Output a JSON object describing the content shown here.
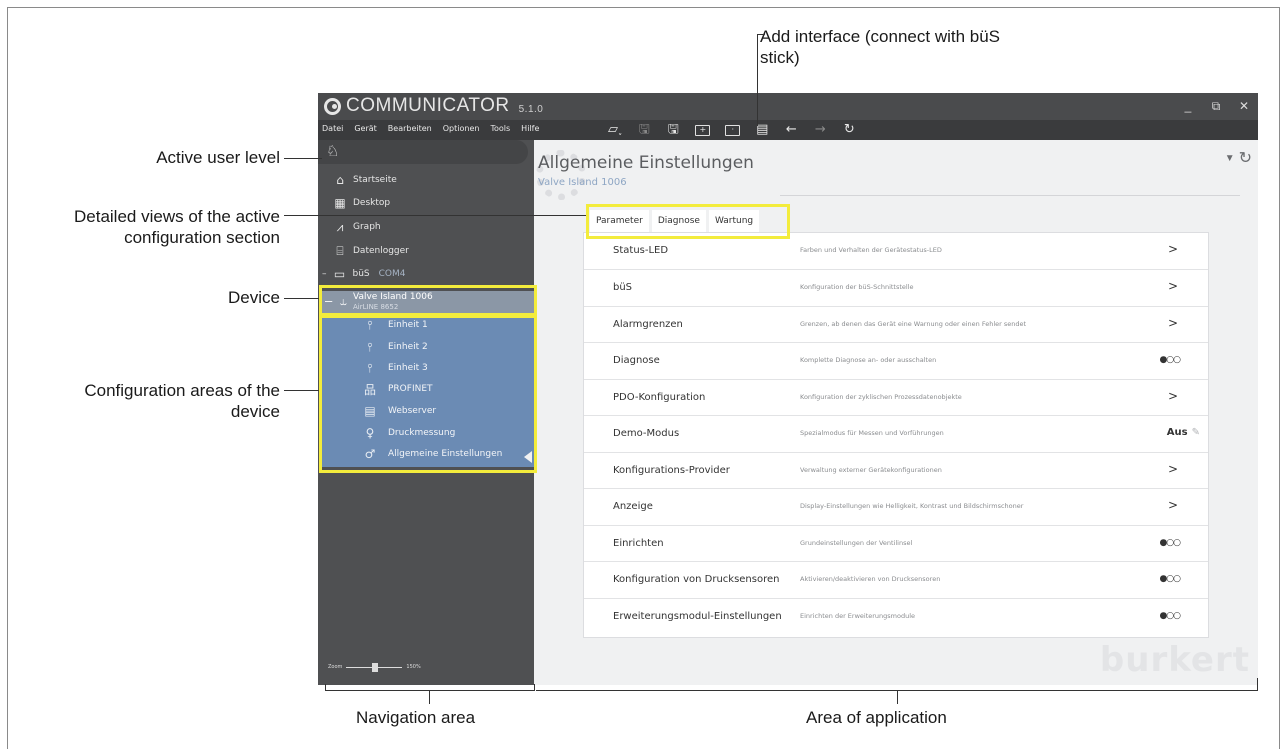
{
  "window": {
    "app_name": "COMMUNICATOR",
    "version": "5.1.0",
    "controls": [
      "_",
      "⧉",
      "✕"
    ]
  },
  "menu": [
    "Datei",
    "Gerät",
    "Bearbeiten",
    "Optionen",
    "Tools",
    "Hilfe"
  ],
  "toolbar": {
    "icons": [
      "card-icon",
      "save-icon",
      "save-as-icon",
      "add-interface-icon",
      "interface-icon",
      "export-icon",
      "back-arrow-icon",
      "forward-arrow-icon",
      "refresh-icon"
    ]
  },
  "annotations": {
    "add_interface": "Add interface (connect with büS stick)",
    "active_user_level": "Active user level",
    "detailed_views": "Detailed views of the active configuration section",
    "device": "Device",
    "configuration_areas": "Configuration areas of the device",
    "navigation_area": "Navigation area",
    "area_of_application": "Area of application"
  },
  "nav": {
    "items": [
      {
        "label": "Startseite",
        "icon": "home-icon"
      },
      {
        "label": "Desktop",
        "icon": "desktop-icon"
      },
      {
        "label": "Graph",
        "icon": "graph-icon"
      },
      {
        "label": "Datenlogger",
        "icon": "datalogger-icon"
      }
    ],
    "bus": {
      "label": "büS",
      "port": "COM4",
      "collapse": "–"
    },
    "device": {
      "name": "Valve Island 1006",
      "type": "AirLINE 8652",
      "collapse": "–"
    },
    "config_areas": [
      {
        "label": "Einheit 1",
        "icon": "unit-icon"
      },
      {
        "label": "Einheit 2",
        "icon": "unit-icon"
      },
      {
        "label": "Einheit 3",
        "icon": "unit-icon"
      },
      {
        "label": "PROFINET",
        "icon": "network-icon"
      },
      {
        "label": "Webserver",
        "icon": "webserver-icon"
      },
      {
        "label": "Druckmessung",
        "icon": "pressure-icon"
      },
      {
        "label": "Allgemeine Einstellungen",
        "icon": "settings-icon"
      }
    ],
    "zoom_label": "Zoom",
    "zoom_value": "150%"
  },
  "main": {
    "title": "Allgemeine Einstellungen",
    "subtitle": "Valve Island 1006",
    "tabs": [
      "Parameter",
      "Diagnose",
      "Wartung"
    ],
    "rows": [
      {
        "label": "Status-LED",
        "desc": "Farben und Verhalten der Gerätestatus-LED",
        "ctrl": ">",
        "kind": "arrow"
      },
      {
        "label": "büS",
        "desc": "Konfiguration der büS-Schnittstelle",
        "ctrl": ">",
        "kind": "arrow"
      },
      {
        "label": "Alarmgrenzen",
        "desc": "Grenzen, ab denen das Gerät eine Warnung oder einen Fehler sendet",
        "ctrl": ">",
        "kind": "arrow"
      },
      {
        "label": "Diagnose",
        "desc": "Komplette Diagnose an- oder ausschalten",
        "ctrl": "●○○",
        "kind": "toggle"
      },
      {
        "label": "PDO-Konfiguration",
        "desc": "Konfiguration der zyklischen Prozessdatenobjekte",
        "ctrl": ">",
        "kind": "arrow"
      },
      {
        "label": "Demo-Modus",
        "desc": "Spezialmodus für Messen und Vorführungen",
        "ctrl": "Aus",
        "kind": "aus"
      },
      {
        "label": "Konfigurations-Provider",
        "desc": "Verwaltung externer Gerätekonfigurationen",
        "ctrl": ">",
        "kind": "arrow"
      },
      {
        "label": "Anzeige",
        "desc": "Display-Einstellungen wie Helligkeit, Kontrast und Bildschirmschoner",
        "ctrl": ">",
        "kind": "arrow"
      },
      {
        "label": "Einrichten",
        "desc": "Grundeinstellungen der Ventilinsel",
        "ctrl": "●○○",
        "kind": "toggle"
      },
      {
        "label": "Konfiguration von Drucksensoren",
        "desc": "Aktivieren/deaktivieren von Drucksensoren",
        "ctrl": "●○○",
        "kind": "toggle"
      },
      {
        "label": "Erweiterungsmodul-Einstellungen",
        "desc": "Einrichten der Erweiterungsmodule",
        "ctrl": "●○○",
        "kind": "toggle"
      }
    ],
    "brand": "burkert"
  },
  "colors": {
    "highlight": "#f3ec3c",
    "titlebar": "#4a4b4d",
    "nav": "#4f5052",
    "device_group": "#6b8bb4",
    "accent_text": "#8ea6c4"
  }
}
